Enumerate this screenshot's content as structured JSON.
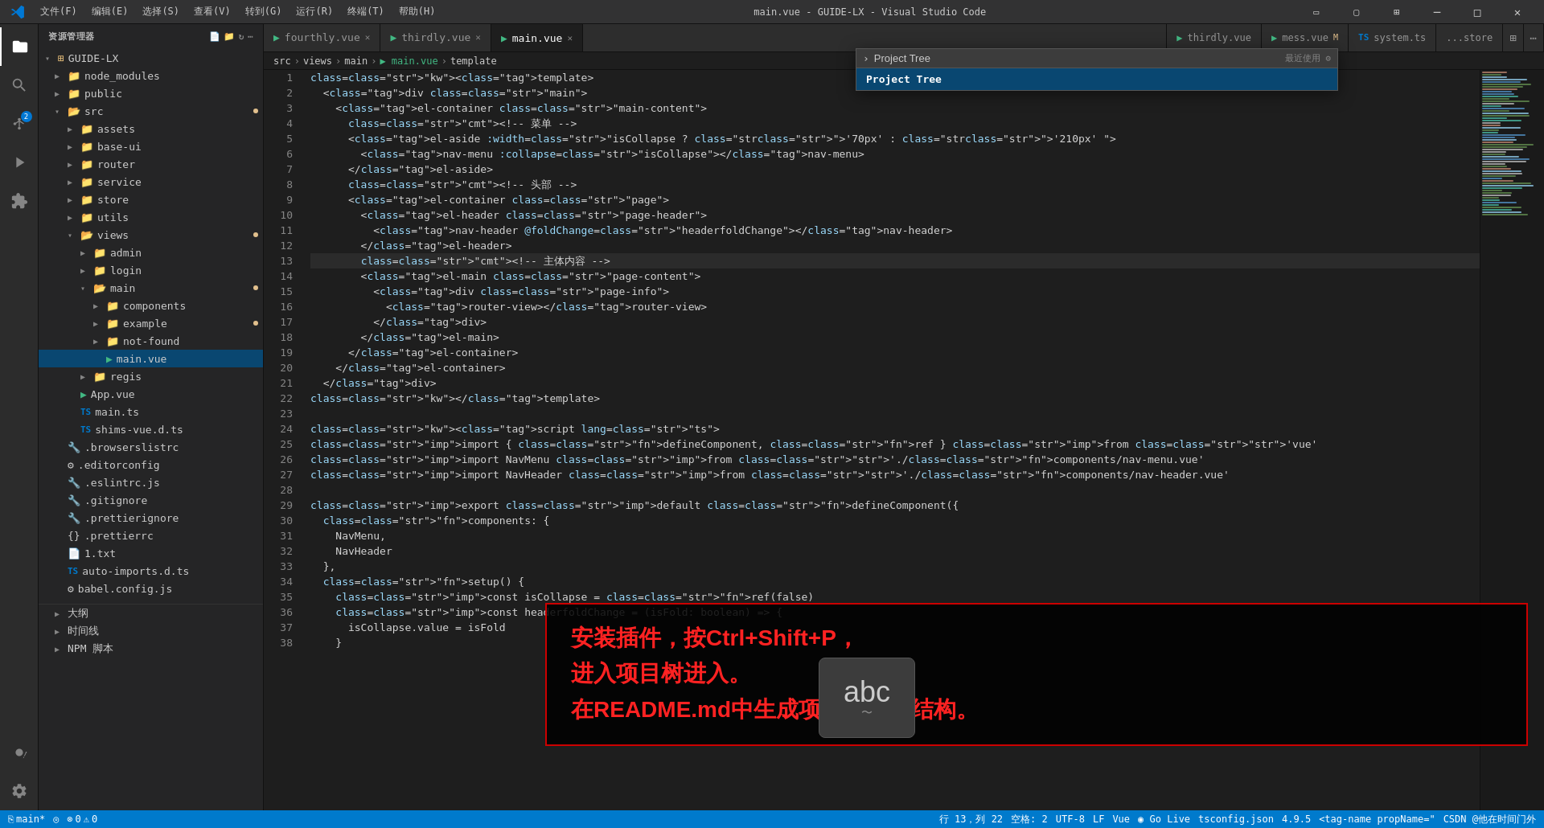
{
  "titleBar": {
    "logo": "◈",
    "menus": [
      "文件(F)",
      "编辑(E)",
      "选择(S)",
      "查看(V)",
      "转到(G)",
      "运行(R)",
      "终端(T)",
      "帮助(H)"
    ],
    "title": "main.vue - GUIDE-LX - Visual Studio Code",
    "winBtns": [
      "─",
      "□",
      "✕"
    ]
  },
  "activityBar": {
    "icons": [
      "⎘",
      "🔍",
      "⑂",
      "⬡",
      "▶",
      "⊞",
      "⊙"
    ],
    "badge": "2"
  },
  "sidebar": {
    "header": "资源管理器",
    "rootLabel": "GUIDE-LX",
    "tree": [
      {
        "level": 1,
        "type": "folder",
        "collapsed": true,
        "label": "node_modules",
        "dot": false
      },
      {
        "level": 1,
        "type": "folder",
        "collapsed": true,
        "label": "public",
        "dot": false
      },
      {
        "level": 1,
        "type": "folder",
        "collapsed": false,
        "label": "src",
        "dot": true
      },
      {
        "level": 2,
        "type": "folder",
        "collapsed": true,
        "label": "assets",
        "dot": false
      },
      {
        "level": 2,
        "type": "folder",
        "collapsed": true,
        "label": "base-ui",
        "dot": false
      },
      {
        "level": 2,
        "type": "folder",
        "collapsed": true,
        "label": "router",
        "dot": false
      },
      {
        "level": 2,
        "type": "folder",
        "collapsed": true,
        "label": "service",
        "dot": false
      },
      {
        "level": 2,
        "type": "folder",
        "collapsed": true,
        "label": "store",
        "dot": false
      },
      {
        "level": 2,
        "type": "folder",
        "collapsed": true,
        "label": "utils",
        "dot": false
      },
      {
        "level": 2,
        "type": "folder",
        "collapsed": false,
        "label": "views",
        "dot": true
      },
      {
        "level": 3,
        "type": "folder",
        "collapsed": true,
        "label": "admin",
        "dot": false
      },
      {
        "level": 3,
        "type": "folder",
        "collapsed": true,
        "label": "login",
        "dot": false
      },
      {
        "level": 3,
        "type": "folder",
        "collapsed": false,
        "label": "main",
        "dot": true
      },
      {
        "level": 4,
        "type": "folder",
        "collapsed": true,
        "label": "components",
        "dot": false
      },
      {
        "level": 4,
        "type": "folder",
        "collapsed": false,
        "label": "example",
        "dot": true
      },
      {
        "level": 4,
        "type": "folder",
        "collapsed": true,
        "label": "not-found",
        "dot": false
      },
      {
        "level": 4,
        "type": "file",
        "collapsed": false,
        "label": "main.vue",
        "dot": false,
        "selected": true
      },
      {
        "level": 3,
        "type": "folder",
        "collapsed": true,
        "label": "regis",
        "dot": false
      },
      {
        "level": 2,
        "type": "file-vue",
        "label": "App.vue",
        "dot": false
      },
      {
        "level": 2,
        "type": "file-ts",
        "label": "main.ts",
        "dot": false
      },
      {
        "level": 2,
        "type": "file-ts",
        "label": "shims-vue.d.ts",
        "dot": false
      },
      {
        "level": 1,
        "type": "file-dot",
        "label": ".browserslistrc",
        "dot": false
      },
      {
        "level": 1,
        "type": "file-gear",
        "label": ".editorconfig",
        "dot": false
      },
      {
        "level": 1,
        "type": "file-dot",
        "label": ".eslintrc.js",
        "dot": false
      },
      {
        "level": 1,
        "type": "file-dot",
        "label": ".gitignore",
        "dot": false
      },
      {
        "level": 1,
        "type": "file-dot",
        "label": ".prettierignore",
        "dot": false
      },
      {
        "level": 1,
        "type": "file-braces",
        "label": ".prettierrc",
        "dot": false
      },
      {
        "level": 1,
        "type": "file",
        "label": "1.txt",
        "dot": false
      },
      {
        "level": 1,
        "type": "file-ts",
        "label": "auto-imports.d.ts",
        "dot": false
      },
      {
        "level": 1,
        "type": "file-gear",
        "label": "babel.config.js",
        "dot": false
      }
    ],
    "bottomItems": [
      "大纲",
      "时间线",
      "NPM 脚本"
    ]
  },
  "tabs": [
    {
      "label": "fourthly.vue",
      "color": "vue",
      "active": false,
      "modified": false
    },
    {
      "label": "thirdly.vue",
      "color": "vue",
      "active": false,
      "modified": false
    },
    {
      "label": "main.vue",
      "color": "vue",
      "active": true,
      "modified": false
    }
  ],
  "rightTabs": [
    {
      "label": "thirdly.vue",
      "color": "vue"
    },
    {
      "label": "mess.vue",
      "color": "vue",
      "modified": true
    },
    {
      "label": "system.ts",
      "color": "ts"
    },
    {
      "label": "...store"
    }
  ],
  "breadcrumb": {
    "items": [
      "src",
      ">",
      "views",
      ">",
      "main",
      ">",
      "main.vue",
      ">",
      "template"
    ]
  },
  "commandPalette": {
    "prompt": ">",
    "inputValue": "Project Tree",
    "result": "Project Tree"
  },
  "recentlyUsed": "最近使用 ⚙",
  "code": {
    "lines": [
      {
        "n": 1,
        "content": "<template>"
      },
      {
        "n": 2,
        "content": "  <div class=\"main\">"
      },
      {
        "n": 3,
        "content": "    <el-container class=\"main-content\">"
      },
      {
        "n": 4,
        "content": "      <!-- 菜单 -->"
      },
      {
        "n": 5,
        "content": "      <el-aside :width=\"isCollapse ? '70px' : '210px' \">"
      },
      {
        "n": 6,
        "content": "        <nav-menu :collapse=\"isCollapse\"></nav-menu>"
      },
      {
        "n": 7,
        "content": "      </el-aside>"
      },
      {
        "n": 8,
        "content": "      <!-- 头部 -->"
      },
      {
        "n": 9,
        "content": "      <el-container class=\"page\">"
      },
      {
        "n": 10,
        "content": "        <el-header class=\"page-header\">"
      },
      {
        "n": 11,
        "content": "          <nav-header @foldChange=\"headerfoldChange\"></nav-header>"
      },
      {
        "n": 12,
        "content": "        </el-header>"
      },
      {
        "n": 13,
        "content": "        <!-- 主体内容 -->"
      },
      {
        "n": 14,
        "content": "        <el-main class=\"page-content\">"
      },
      {
        "n": 15,
        "content": "          <div class=\"page-info\">"
      },
      {
        "n": 16,
        "content": "            <router-view></router-view>"
      },
      {
        "n": 17,
        "content": "          </div>"
      },
      {
        "n": 18,
        "content": "        </el-main>"
      },
      {
        "n": 19,
        "content": "      </el-container>"
      },
      {
        "n": 20,
        "content": "    </el-container>"
      },
      {
        "n": 21,
        "content": "  </div>"
      },
      {
        "n": 22,
        "content": "</template>"
      },
      {
        "n": 23,
        "content": ""
      },
      {
        "n": 24,
        "content": "<script lang=\"ts\">"
      },
      {
        "n": 25,
        "content": "import { defineComponent, ref } from 'vue'"
      },
      {
        "n": 26,
        "content": "import NavMenu from './components/nav-menu.vue'"
      },
      {
        "n": 27,
        "content": "import NavHeader from './components/nav-header.vue'"
      },
      {
        "n": 28,
        "content": ""
      },
      {
        "n": 29,
        "content": "export default defineComponent({"
      },
      {
        "n": 30,
        "content": "  components: {"
      },
      {
        "n": 31,
        "content": "    NavMenu,"
      },
      {
        "n": 32,
        "content": "    NavHeader"
      },
      {
        "n": 33,
        "content": "  },"
      },
      {
        "n": 34,
        "content": "  setup() {"
      },
      {
        "n": 35,
        "content": "    const isCollapse = ref(false)"
      },
      {
        "n": 36,
        "content": "    const headerfoldChange = (isFold: boolean) => {"
      },
      {
        "n": 37,
        "content": "      isCollapse.value = isFold"
      },
      {
        "n": 38,
        "content": "    }"
      }
    ]
  },
  "annotation": {
    "text": "安装插件，按Ctrl+Shift+P，\n进入项目树进入。\n在README.md中生成项目的树状结构。"
  },
  "abcIcon": {
    "text": "abc",
    "wave": "～"
  },
  "statusBar": {
    "left": [
      "⎘ main*",
      "◎",
      "⊗ 0  ⚠ 0"
    ],
    "lineCol": "行 13，列 22",
    "spaces": "空格: 2",
    "encoding": "UTF-8",
    "lineEnding": "LF",
    "language": "Vue",
    "goLive": "◉ Go Live",
    "tsconfig": "tsconfig.json",
    "version": "4.9.5",
    "tagInfo": "<tag-name propName=\"",
    "csdn": "CSDN @他在时间门外"
  }
}
